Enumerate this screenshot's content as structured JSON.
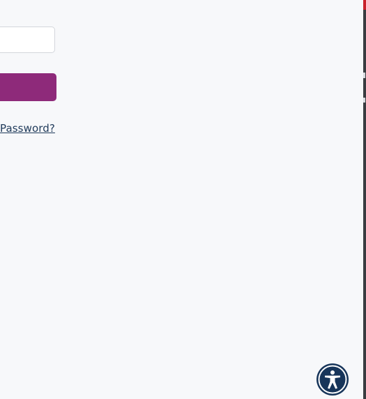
{
  "login_form": {
    "password_input_value": "",
    "submit_label": "",
    "forgot_password_text": "Password?"
  },
  "accessibility": {
    "icon": "accessibility-person-icon"
  },
  "colors": {
    "background": "#f7f8fa",
    "submit_button": "#8e2a7a",
    "link": "#1f3a5a",
    "accessibility_button": "#17355a"
  }
}
